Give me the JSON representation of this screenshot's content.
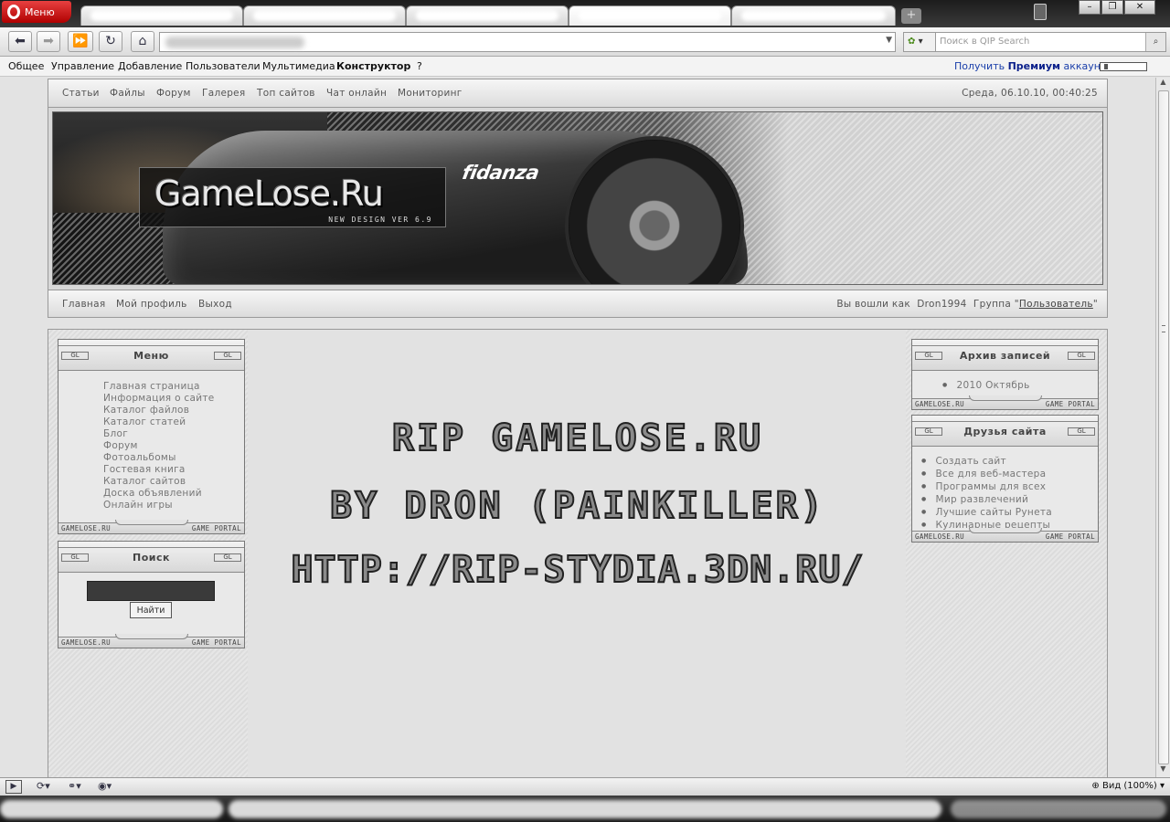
{
  "browser": {
    "menu_button": "Меню",
    "search_placeholder": "Поиск в QIP Search",
    "menus": [
      "Общее",
      "Управление",
      "Добавление",
      "Пользователи",
      "Мультимедиа",
      "Конструктор",
      "?"
    ],
    "premium_prefix": "Получить ",
    "premium_bold": "Премиум",
    "premium_suffix": " аккаунт",
    "zoom": "Вид (100%)"
  },
  "site": {
    "top_nav": [
      "Статьи",
      "Файлы",
      "Форум",
      "Галерея",
      "Топ сайтов",
      "Чат онлайн",
      "Мониторинг"
    ],
    "date": "Среда, 06.10.10, 00:40:25",
    "banner": {
      "logo": "GameLose.Ru",
      "logo_sub": "NEW DESIGN VER 6.9",
      "car_brand": "fidanza"
    },
    "user_nav": [
      "Главная",
      "Мой профиль",
      "Выход"
    ],
    "user_info": {
      "logged_as": "Вы вошли как",
      "username": "Dron1994",
      "group_label": "Группа \"",
      "group": "Пользователь",
      "group_close": "\""
    },
    "block_tag": "GL",
    "footer_left": "GAMELOSE.RU",
    "footer_right": "GAME PORTAL",
    "menu_block": {
      "title": "Меню",
      "items": [
        "Главная страница",
        "Информация о сайте",
        "Каталог файлов",
        "Каталог статей",
        "Блог",
        "Форум",
        "Фотоальбомы",
        "Гостевая книга",
        "Каталог сайтов",
        "Доска объявлений",
        "Онлайн игры"
      ]
    },
    "search_block": {
      "title": "Поиск",
      "button": "Найти"
    },
    "archive_block": {
      "title": "Архив записей",
      "items": [
        "2010 Октябрь"
      ]
    },
    "friends_block": {
      "title": "Друзья сайта",
      "items": [
        "Создать сайт",
        "Все для веб-мастера",
        "Программы для всех",
        "Мир развлечений",
        "Лучшие сайты Рунета",
        "Кулинарные рецепты"
      ]
    },
    "rip_lines": [
      "RIP GAMELOSE.RU",
      "BY DRON (PAINKILLER)",
      "HTTP://RIP-STYDIA.3DN.RU/"
    ]
  }
}
